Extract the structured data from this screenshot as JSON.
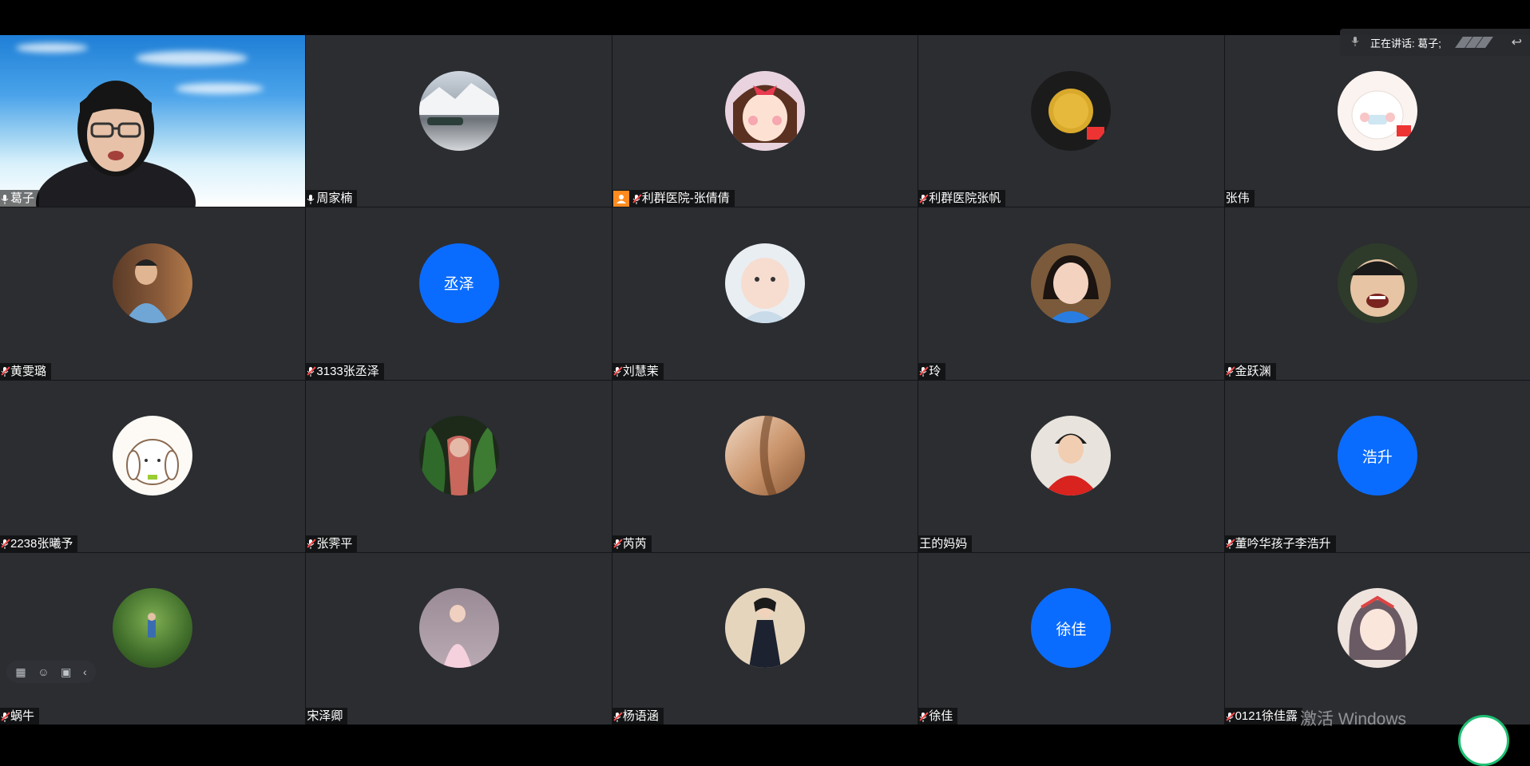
{
  "speaking": {
    "label": "正在讲话: 葛子;"
  },
  "tiles": [
    {
      "name": "葛子"
    },
    {
      "name": "周家楠"
    },
    {
      "name": "利群医院-张倩倩"
    },
    {
      "name": "利群医院张帆"
    },
    {
      "name": "张伟"
    },
    {
      "name": "黄雯璐"
    },
    {
      "name": "3133张丞泽",
      "avatar_text": "丞泽"
    },
    {
      "name": "刘慧茉"
    },
    {
      "name": "玲"
    },
    {
      "name": "金跃渊"
    },
    {
      "name": "2238张曦予"
    },
    {
      "name": "张霁平"
    },
    {
      "name": "芮芮"
    },
    {
      "name": "王的妈妈"
    },
    {
      "name": "董吟华孩子李浩升",
      "avatar_text": "浩升"
    },
    {
      "name": "蜗牛"
    },
    {
      "name": "宋泽卿"
    },
    {
      "name": "杨语涵"
    },
    {
      "name": "徐佳",
      "avatar_text": "徐佳"
    },
    {
      "name": "0121徐佳露"
    }
  ],
  "watermark": "激活 Windows",
  "colors": {
    "tile_bg": "#2b2d31",
    "accent_blue": "#0a6cff",
    "active_border": "#18c37a",
    "mute_red": "#ff4a4a",
    "host_orange": "#ff8a1f"
  }
}
